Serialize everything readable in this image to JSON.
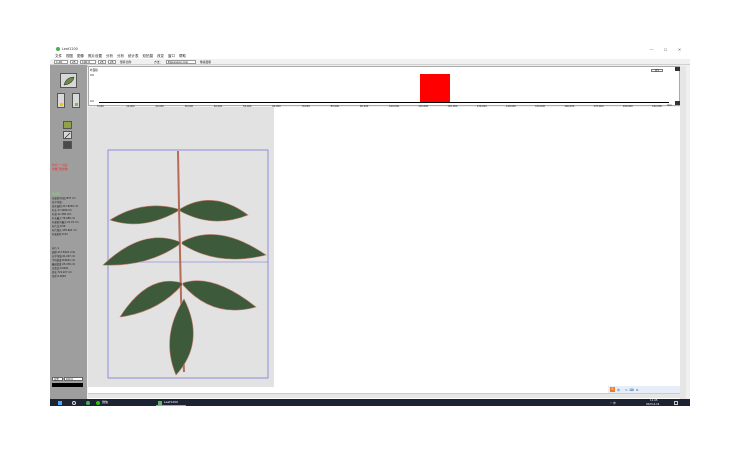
{
  "window": {
    "title": "Leaf1200",
    "minimize": "—",
    "maximize": "☐",
    "close": "✕"
  },
  "menu": [
    "文件",
    "视图",
    "图像",
    "照片设置",
    "分析",
    "分析",
    "统计表",
    "双拍摄",
    "改变",
    "窗口",
    "帮助"
  ],
  "toolbar": {
    "zoom": "1.00 ",
    "field2": "25",
    "field3": "100.0 mm",
    "field4": "25",
    "field5": "25",
    "label1": "量算比例:",
    "label2": "方法：",
    "method": "Expansion Cal",
    "label3": "像素面积"
  },
  "histogram": {
    "ylabel": "叶面积",
    "yvalue_top": "0.8",
    "yvalue_bottom": "0.0",
    "ticks": [
      "5,000",
      "10,000",
      "20,000",
      "30,000",
      "40,000",
      "50,000",
      "60,000",
      "70,000",
      "80,000",
      "90,000",
      "100,000",
      "110,000",
      "120,000",
      "130,000",
      "140,000",
      "150,000",
      "160,000",
      "170,000",
      "180,000",
      "190,000"
    ],
    "unit": "mm",
    "corner_btn": "显示",
    "bar_range": [
      110000,
      120000
    ],
    "bar_level": 0.85
  },
  "left_panel": {
    "red_lines": [
      "叶片一一对应",
      "参数已经参数"
    ],
    "green_label": "叶片值",
    "stats1": [
      "总面积(有效):837 cm",
      "总平均值:",
      "总叶面积:117.8239 cm",
      "叶长:17.2266 cm",
      "叶宽:11.338 mm",
      "叶长最大:76.286 cm",
      "叶面积中最大:21.47 cm",
      "叶片比:0.59",
      "叶片周长:135.601 cm",
      "叶面形状:0.63"
    ],
    "stats2": [
      "叶片:1",
      "面积:117.8324 cm2",
      "长平均值:41.247 cm",
      "平均宽度:8.6621 cm",
      "最高宽度:25.476 cm",
      "长宽比:4.0491",
      "周长:721.227 cm",
      "形状:0.0093"
    ],
    "bottom_label": "位置",
    "bottom_value": "100.0"
  },
  "ime": {
    "logo": "S",
    "items": [
      "中",
      "·",
      "⊙",
      "⌨",
      "⚙"
    ]
  },
  "taskbar": {
    "app1": "微信",
    "app2": "Leaf1200",
    "time": "11:45",
    "date": "2023-4-14",
    "tray": "◠ 中"
  },
  "colors": {
    "histogram_bar": "#ff0000",
    "leaf": "#3d5a3a",
    "stem": "#b56b58",
    "selection": "#6a6ad8"
  }
}
